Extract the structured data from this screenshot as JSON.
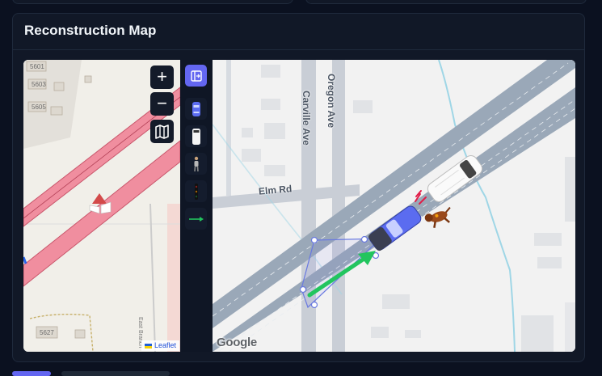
{
  "panel": {
    "title": "Reconstruction Map"
  },
  "left_map": {
    "zoom_in_label": "+",
    "zoom_out_label": "−",
    "address_labels": [
      "5601",
      "5603",
      "5605",
      "5627"
    ],
    "street_label": "East Branch",
    "attribution": "Leaflet"
  },
  "right_map": {
    "streets": [
      "Elm Rd",
      "Carville Ave",
      "Oregon Ave"
    ],
    "provider": "Google"
  },
  "toolbar": {
    "tools": [
      "panel-toggle-icon",
      "car-icon",
      "van-icon",
      "pedestrian-icon",
      "traffic-light-icon",
      "arrow-icon"
    ],
    "active_tool": "panel-toggle-icon"
  },
  "colors": {
    "accent": "#6366f1",
    "road_highlight": "#f08e9f",
    "trajectory": "#22c55e"
  }
}
